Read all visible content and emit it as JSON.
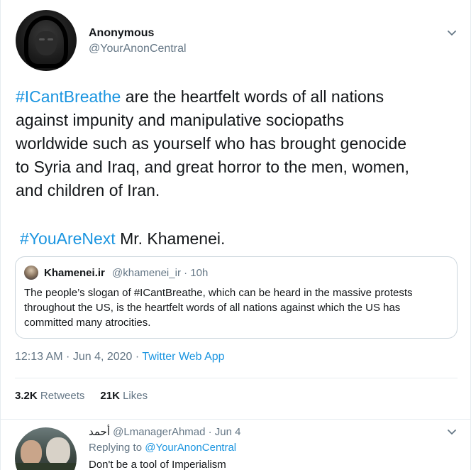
{
  "tweet": {
    "author_name": "Anonymous",
    "author_handle": "@YourAnonCentral",
    "lines": [
      {
        "hashtag": "#ICantBreathe",
        "rest": " are the heartfelt words of all nations"
      },
      {
        "text": "against impunity and manipulative sociopaths"
      },
      {
        "text": "worldwide such as yourself who has brought genocide"
      },
      {
        "text": "to Syria and Iraq, and great horror to the men, women,"
      },
      {
        "text": "and children of Iran."
      }
    ],
    "second_hashtag": "#YouAreNext",
    "second_rest": " Mr. Khamenei.",
    "timestamp": "12:13 AM · Jun 4, 2020 · ",
    "app": "Twitter Web App",
    "retweets_count": "3.2K",
    "retweets_label": " Retweets",
    "likes_count": "21K",
    "likes_label": " Likes"
  },
  "quote": {
    "name": "Khamenei.ir",
    "meta": "@khamenei_ir · 10h",
    "lines": [
      "The people’s slogan of #ICantBreathe, which can be heard in the massive protests",
      "throughout the US, is the heartfelt words of all nations against which the US has",
      "committed many atrocities."
    ]
  },
  "reply": {
    "name": "أحمد",
    "meta": " @LmanagerAhmad · Jun 4",
    "replying_prefix": "Replying to ",
    "replying_handle": "@YourAnonCentral",
    "text": "Don't be a tool of Imperialism"
  },
  "icons": {
    "tweet_menu": "chevron-down-icon",
    "reply_menu": "chevron-down-icon"
  },
  "colors": {
    "link": "#1b95e0",
    "secondary_text": "#657786",
    "primary_text": "#14171a",
    "border": "#e6ecf0"
  }
}
